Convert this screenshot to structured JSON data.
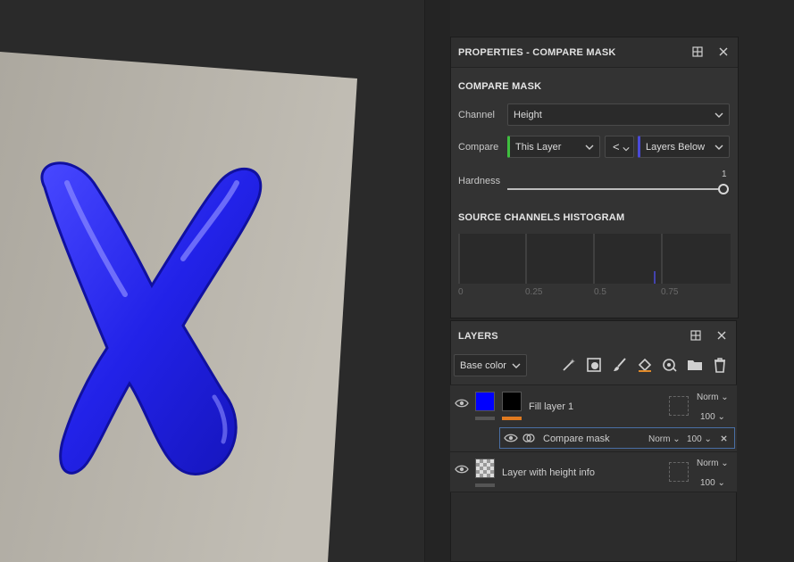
{
  "properties_panel": {
    "title": "PROPERTIES - COMPARE MASK",
    "section_title": "COMPARE MASK",
    "channel_label": "Channel",
    "channel_value": "Height",
    "compare_label": "Compare",
    "compare_left_value": "This Layer",
    "compare_operator": "<",
    "compare_right_value": "Layers Below",
    "hardness_label": "Hardness",
    "hardness_value": "1",
    "histogram_title": "SOURCE CHANNELS HISTOGRAM",
    "histogram_ticks": [
      "0",
      "0.25",
      "0.5",
      "0.75"
    ]
  },
  "layers_panel": {
    "title": "LAYERS",
    "channel_select": "Base color",
    "layers": [
      {
        "name": "Fill layer 1",
        "blend": "Norm",
        "opacity": "100"
      },
      {
        "name": "Compare mask",
        "blend": "Norm",
        "opacity": "100"
      },
      {
        "name": "Layer with height info",
        "blend": "Norm",
        "opacity": "100"
      }
    ]
  },
  "viewport": {
    "letter_color": "#2a2aff",
    "plane_color": "#b4b0a8"
  },
  "icons": [
    "dock-icon",
    "close-icon",
    "chevron-down-icon",
    "magic-wand-icon",
    "smart-mask-icon",
    "brush-icon",
    "fill-icon",
    "effects-icon",
    "folder-icon",
    "trash-icon",
    "eye-icon",
    "mask-icon"
  ]
}
